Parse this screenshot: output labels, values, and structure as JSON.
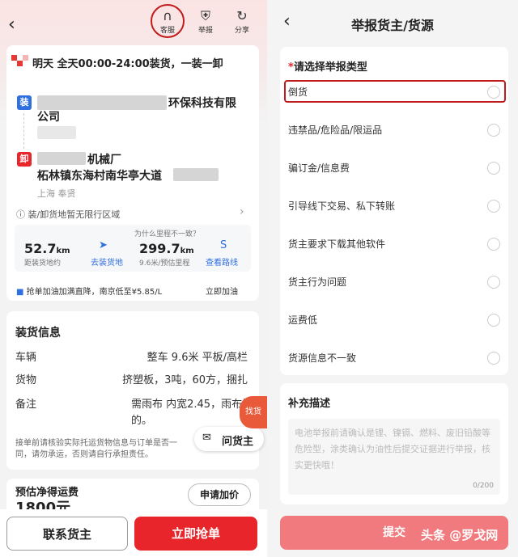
{
  "left": {
    "header": {
      "service_label": "客服",
      "report_label": "举报",
      "share_label": "分享"
    },
    "time_text": "明天 全天00:00-24:00装货，一装一卸",
    "load": {
      "tag": "装",
      "name_tail": "环保科技有限",
      "name_line2": "公司"
    },
    "unload": {
      "tag": "卸",
      "name_tail": "机械厂",
      "address": "柘林镇东海村南华亭大道",
      "city": "上海 奉贤"
    },
    "no_limit": "装/卸货地暂无限行区域",
    "dist_question": "为什么里程不一致？",
    "dist1": {
      "value": "52.7",
      "unit": "km",
      "label": "距装货地约"
    },
    "nav_load": "去装货地",
    "dist2": {
      "value": "299.7",
      "unit": "km",
      "label": "9.6米/预估里程"
    },
    "view_route": "查看路线",
    "fuel": {
      "text": "抢单加油加满直降，南京低至¥5.85/L",
      "action": "立即加油"
    },
    "info": {
      "title": "装货信息",
      "rows": [
        {
          "label": "车辆",
          "value": "整车 9.6米 平板/高栏"
        },
        {
          "label": "货物",
          "value": "挤塑板，3吨，60方，捆扎"
        },
        {
          "label": "备注",
          "value": "需雨布 内宽2.45，雨布好",
          "value2": "的。"
        }
      ],
      "notice1": "接单前请核验实际托运货物信息与订单是否一",
      "notice2": "同，请勿承运，否则请自行承担责任。",
      "ask_owner": "问货主",
      "mascot_text": "找货"
    },
    "estimate": {
      "title": "预估净得运费",
      "value": "1800元",
      "apply_btn": "申请加价"
    },
    "contact_btn": "联系货主",
    "grab_btn": "立即抢单"
  },
  "right": {
    "title": "举报货主/货源",
    "select_title": "请选择举报类型",
    "required_mark": "*",
    "options": [
      "倒货",
      "违禁品/危险品/限运品",
      "骗订金/信息费",
      "引导线下交易、私下转账",
      "货主要求下载其他软件",
      "货主行为问题",
      "运费低",
      "货源信息不一致"
    ],
    "supplement_title": "补充描述",
    "placeholder": "电池举报前请确认是锂、镍镉、燃料、废旧铅酸等危险型，涂类确认为油性后提交证据进行举报，核实更快哦！",
    "counter": "0/200",
    "submit_btn": "提交",
    "watermark": "头条 @罗戈网"
  },
  "colors": {
    "accent": "#e8252b",
    "blue": "#2f6fe0",
    "highlight": "#c21b1b"
  }
}
